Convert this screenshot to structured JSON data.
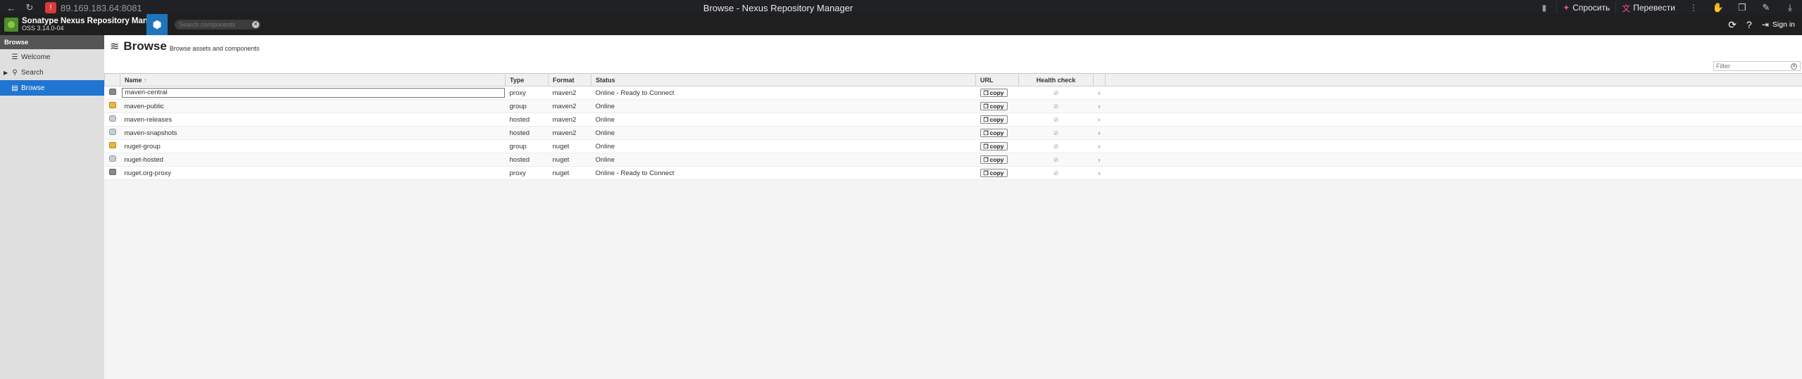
{
  "browser": {
    "url": "89.169.183.64:8081",
    "tab_title": "Browse - Nexus Repository Manager",
    "ask_label": "Спросить",
    "translate_label": "Перевести",
    "profile_badge": "1"
  },
  "header": {
    "product_name": "Sonatype Nexus Repository Manager",
    "version": "OSS 3.14.0-04",
    "search_placeholder": "Search components",
    "sign_in": "Sign in"
  },
  "sidebar": {
    "section": "Browse",
    "items": [
      {
        "label": "Welcome",
        "icon": "list-icon"
      },
      {
        "label": "Search",
        "icon": "search-icon"
      },
      {
        "label": "Browse",
        "icon": "database-icon"
      }
    ]
  },
  "page": {
    "title": "Browse",
    "subtitle": "Browse assets and components",
    "filter_placeholder": "Filter"
  },
  "table": {
    "columns": {
      "name": "Name",
      "sort_indicator": "↑",
      "type": "Type",
      "format": "Format",
      "status": "Status",
      "url": "URL",
      "health": "Health check"
    },
    "copy_label": "copy",
    "rows": [
      {
        "name": "maven-central",
        "type": "proxy",
        "format": "maven2",
        "status": "Online - Ready to Connect"
      },
      {
        "name": "maven-public",
        "type": "group",
        "format": "maven2",
        "status": "Online"
      },
      {
        "name": "maven-releases",
        "type": "hosted",
        "format": "maven2",
        "status": "Online"
      },
      {
        "name": "maven-snapshots",
        "type": "hosted",
        "format": "maven2",
        "status": "Online"
      },
      {
        "name": "nuget-group",
        "type": "group",
        "format": "nuget",
        "status": "Online"
      },
      {
        "name": "nuget-hosted",
        "type": "hosted",
        "format": "nuget",
        "status": "Online"
      },
      {
        "name": "nuget.org-proxy",
        "type": "proxy",
        "format": "nuget",
        "status": "Online - Ready to Connect"
      }
    ]
  },
  "colors": {
    "accent": "#1f75cf",
    "header_bg": "#1f1f1f",
    "sidebar_bg": "#dfdfdf"
  }
}
